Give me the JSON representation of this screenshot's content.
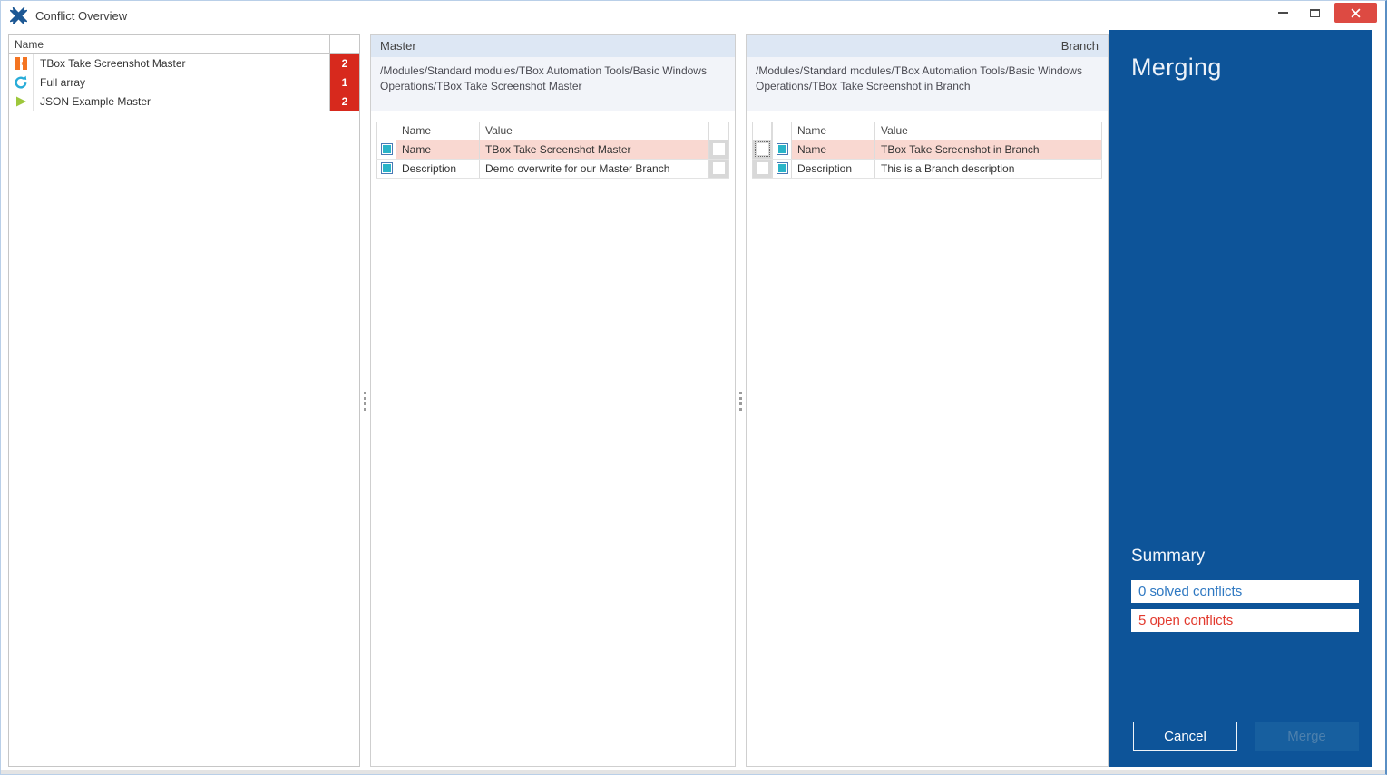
{
  "window": {
    "title": "Conflict Overview"
  },
  "conflict_list": {
    "name_header": "Name",
    "items": [
      {
        "icon": "tbox-module-icon",
        "label": "TBox Take Screenshot Master",
        "count": "2"
      },
      {
        "icon": "sync-icon",
        "label": "Full array",
        "count": "1"
      },
      {
        "icon": "play-icon",
        "label": "JSON Example Master",
        "count": "2"
      }
    ]
  },
  "master_panel": {
    "title": "Master",
    "path": "/Modules/Standard modules/TBox Automation Tools/Basic Windows Operations/TBox Take Screenshot Master",
    "columns": {
      "name": "Name",
      "value": "Value"
    },
    "rows": [
      {
        "name": "Name",
        "value": "TBox Take Screenshot Master"
      },
      {
        "name": "Description",
        "value": "Demo overwrite for our Master Branch"
      }
    ]
  },
  "branch_panel": {
    "title": "Branch",
    "path": "/Modules/Standard modules/TBox Automation Tools/Basic Windows Operations/TBox Take Screenshot in Branch",
    "columns": {
      "name": "Name",
      "value": "Value"
    },
    "rows": [
      {
        "name": "Name",
        "value": "TBox Take Screenshot in Branch"
      },
      {
        "name": "Description",
        "value": "This is a Branch description"
      }
    ]
  },
  "merge_panel": {
    "title": "Merging",
    "summary_title": "Summary",
    "solved_label": "0 solved conflicts",
    "open_label": "5 open conflicts",
    "cancel_label": "Cancel",
    "merge_label": "Merge"
  },
  "colors": {
    "accent_blue": "#0d5499",
    "conflict_badge_red": "#d7291d",
    "highlight_pink": "#f9d8d1",
    "checkbox_teal": "#2ab4c8",
    "panel_header_blue": "#dde7f4",
    "solved_text_blue": "#2e78c2",
    "open_text_red": "#e23a2e",
    "close_button_red": "#dd4a42"
  }
}
